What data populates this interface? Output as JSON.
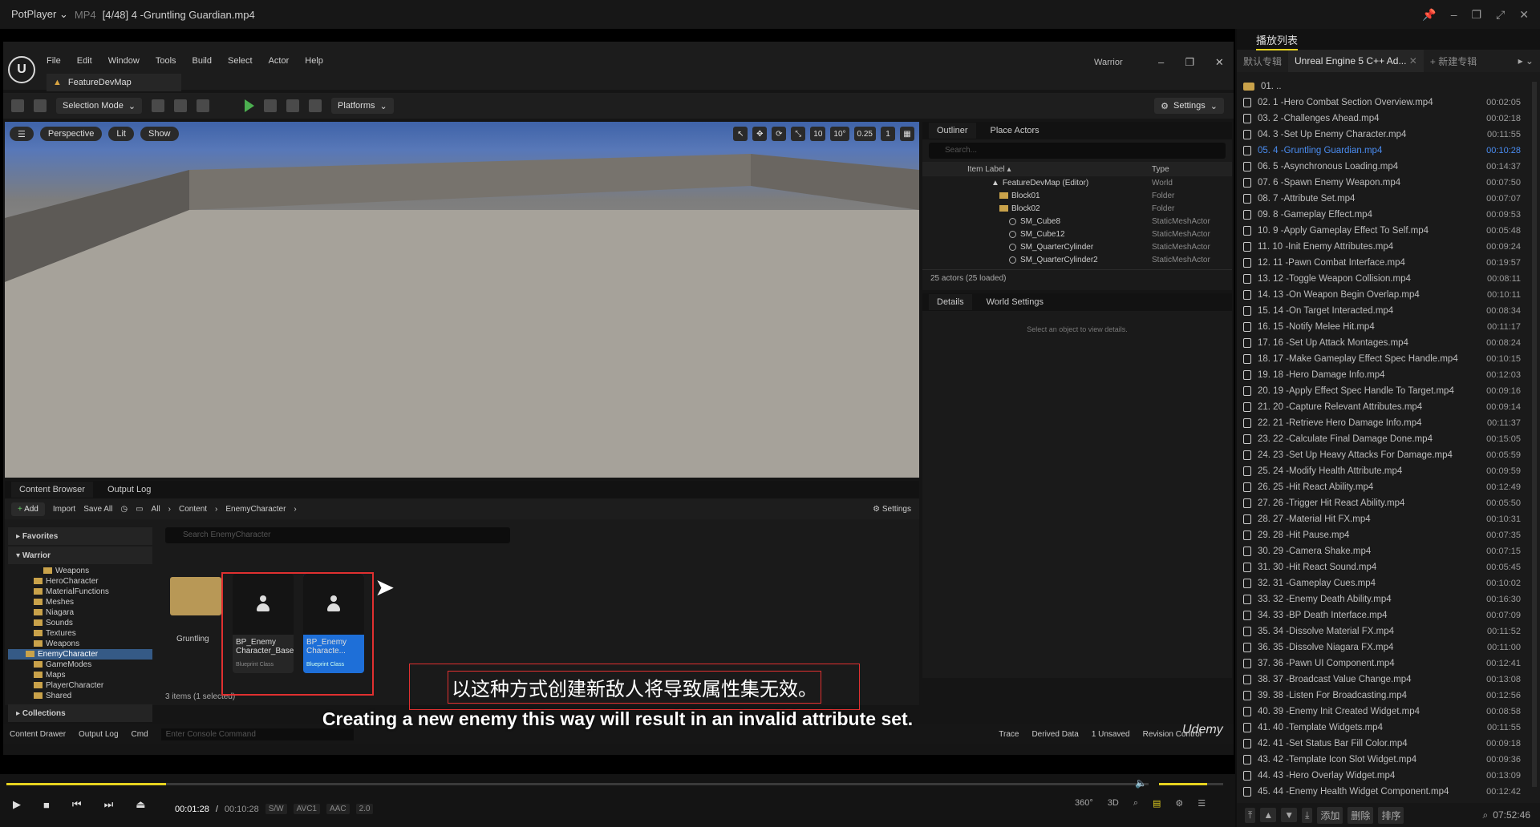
{
  "player": {
    "app": "PotPlayer",
    "format": "MP4",
    "title": "[4/48] 4 -Gruntling Guardian.mp4"
  },
  "ue": {
    "menu": [
      "File",
      "Edit",
      "Window",
      "Tools",
      "Build",
      "Select",
      "Actor",
      "Help"
    ],
    "map_tab": "FeatureDevMap",
    "project": "Warrior",
    "toolbar": {
      "mode": "Selection Mode",
      "platforms": "Platforms",
      "settings": "Settings"
    },
    "viewport": {
      "perspective": "Perspective",
      "lit": "Lit",
      "show": "Show",
      "grid": "10",
      "rot": "10°",
      "scale": "0.25",
      "cam": "1"
    },
    "outliner": {
      "tab1": "Outliner",
      "tab2": "Place Actors",
      "search": "Search...",
      "col_label": "Item Label ▴",
      "col_type": "Type",
      "rows": [
        {
          "label": "FeatureDevMap (Editor)",
          "type": "World"
        },
        {
          "label": "Block01",
          "type": "Folder"
        },
        {
          "label": "Block02",
          "type": "Folder"
        },
        {
          "label": "SM_Cube8",
          "type": "StaticMeshActor"
        },
        {
          "label": "SM_Cube12",
          "type": "StaticMeshActor"
        },
        {
          "label": "SM_QuarterCylinder",
          "type": "StaticMeshActor"
        },
        {
          "label": "SM_QuarterCylinder2",
          "type": "StaticMeshActor"
        }
      ],
      "count": "25 actors (25 loaded)"
    },
    "details": {
      "tab1": "Details",
      "tab2": "World Settings",
      "empty": "Select an object to view details."
    },
    "cb": {
      "tab1": "Content Browser",
      "tab2": "Output Log",
      "add": "Add",
      "import": "Import",
      "saveall": "Save All",
      "path": [
        "All",
        "Content",
        "EnemyCharacter"
      ],
      "settings": "Settings",
      "favorites": "Favorites",
      "warrior": "Warrior",
      "search": "Search EnemyCharacter",
      "tree": [
        "Weapons",
        "HeroCharacter",
        "MaterialFunctions",
        "Meshes",
        "Niagara",
        "Sounds",
        "Textures",
        "Weapons",
        "EnemyCharacter",
        "GameModes",
        "Maps",
        "PlayerCharacter",
        "Shared"
      ],
      "folder": "Gruntling",
      "asset1": "BP_Enemy Character_Base",
      "asset2": "BP_Enemy Characte...",
      "cls": "Blueprint Class",
      "collections": "Collections",
      "count": "3 items (1 selected)"
    },
    "status": {
      "drawer": "Content Drawer",
      "outlog": "Output Log",
      "cmd": "Cmd",
      "console": "Enter Console Command",
      "trace": "Trace",
      "derived": "Derived Data",
      "unsaved": "1 Unsaved",
      "rev": "Revision Control"
    }
  },
  "subtitle": {
    "zh": "以这种方式创建新敌人将导致属性集无效。",
    "en": "Creating a new enemy this way will result in an invalid attribute set."
  },
  "watermark": "Udemy",
  "playback": {
    "time": "00:01:28",
    "total": "00:10:28",
    "sw": "S/W",
    "vcodec": "AVC1",
    "acodec": "AAC",
    "ach": "2.0",
    "progress": 0.14
  },
  "playlist": {
    "title": "播放列表",
    "tabs": [
      "默认专辑",
      "Unreal Engine 5 C++ Ad...",
      "+ 新建专辑"
    ],
    "clock": "07:52:46",
    "foot": [
      "添加",
      "删除",
      "排序"
    ],
    "items": [
      {
        "n": "01. ..",
        "d": "",
        "folder": true
      },
      {
        "n": "02. 1 -Hero Combat Section Overview.mp4",
        "d": "00:02:05"
      },
      {
        "n": "03. 2 -Challenges Ahead.mp4",
        "d": "00:02:18"
      },
      {
        "n": "04. 3 -Set Up Enemy Character.mp4",
        "d": "00:11:55"
      },
      {
        "n": "05. 4 -Gruntling Guardian.mp4",
        "d": "00:10:28",
        "cur": true
      },
      {
        "n": "06. 5 -Asynchronous Loading.mp4",
        "d": "00:14:37"
      },
      {
        "n": "07. 6 -Spawn Enemy Weapon.mp4",
        "d": "00:07:50"
      },
      {
        "n": "08. 7 -Attribute Set.mp4",
        "d": "00:07:07"
      },
      {
        "n": "09. 8 -Gameplay Effect.mp4",
        "d": "00:09:53"
      },
      {
        "n": "10. 9 -Apply Gameplay Effect To Self.mp4",
        "d": "00:05:48"
      },
      {
        "n": "11. 10 -Init Enemy Attributes.mp4",
        "d": "00:09:24"
      },
      {
        "n": "12. 11 -Pawn Combat Interface.mp4",
        "d": "00:19:57"
      },
      {
        "n": "13. 12 -Toggle Weapon Collision.mp4",
        "d": "00:08:11"
      },
      {
        "n": "14. 13 -On Weapon Begin Overlap.mp4",
        "d": "00:10:11"
      },
      {
        "n": "15. 14 -On Target Interacted.mp4",
        "d": "00:08:34"
      },
      {
        "n": "16. 15 -Notify Melee Hit.mp4",
        "d": "00:11:17"
      },
      {
        "n": "17. 16 -Set Up Attack Montages.mp4",
        "d": "00:08:24"
      },
      {
        "n": "18. 17 -Make Gameplay Effect Spec Handle.mp4",
        "d": "00:10:15"
      },
      {
        "n": "19. 18 -Hero Damage Info.mp4",
        "d": "00:12:03"
      },
      {
        "n": "20. 19 -Apply Effect Spec Handle To Target.mp4",
        "d": "00:09:16"
      },
      {
        "n": "21. 20 -Capture Relevant Attributes.mp4",
        "d": "00:09:14"
      },
      {
        "n": "22. 21 -Retrieve Hero Damage Info.mp4",
        "d": "00:11:37"
      },
      {
        "n": "23. 22 -Calculate Final Damage Done.mp4",
        "d": "00:15:05"
      },
      {
        "n": "24. 23 -Set Up Heavy Attacks For Damage.mp4",
        "d": "00:05:59"
      },
      {
        "n": "25. 24 -Modify Health Attribute.mp4",
        "d": "00:09:59"
      },
      {
        "n": "26. 25 -Hit React Ability.mp4",
        "d": "00:12:49"
      },
      {
        "n": "27. 26 -Trigger Hit React Ability.mp4",
        "d": "00:05:50"
      },
      {
        "n": "28. 27 -Material Hit FX.mp4",
        "d": "00:10:31"
      },
      {
        "n": "29. 28 -Hit Pause.mp4",
        "d": "00:07:35"
      },
      {
        "n": "30. 29 -Camera Shake.mp4",
        "d": "00:07:15"
      },
      {
        "n": "31. 30 -Hit React Sound.mp4",
        "d": "00:05:45"
      },
      {
        "n": "32. 31 -Gameplay Cues.mp4",
        "d": "00:10:02"
      },
      {
        "n": "33. 32 -Enemy Death Ability.mp4",
        "d": "00:16:30"
      },
      {
        "n": "34. 33 -BP Death Interface.mp4",
        "d": "00:07:09"
      },
      {
        "n": "35. 34 -Dissolve Material FX.mp4",
        "d": "00:11:52"
      },
      {
        "n": "36. 35 -Dissolve Niagara FX.mp4",
        "d": "00:11:00"
      },
      {
        "n": "37. 36 -Pawn UI Component.mp4",
        "d": "00:12:41"
      },
      {
        "n": "38. 37 -Broadcast Value Change.mp4",
        "d": "00:13:08"
      },
      {
        "n": "39. 38 -Listen For Broadcasting.mp4",
        "d": "00:12:56"
      },
      {
        "n": "40. 39 -Enemy Init Created Widget.mp4",
        "d": "00:08:58"
      },
      {
        "n": "41. 40 -Template Widgets.mp4",
        "d": "00:11:55"
      },
      {
        "n": "42. 41 -Set Status Bar Fill Color.mp4",
        "d": "00:09:18"
      },
      {
        "n": "43. 42 -Template Icon Slot Widget.mp4",
        "d": "00:09:36"
      },
      {
        "n": "44. 43 -Hero Overlay Widget.mp4",
        "d": "00:13:09"
      },
      {
        "n": "45. 44 -Enemy Health Widget Component.mp4",
        "d": "00:12:42"
      }
    ]
  }
}
